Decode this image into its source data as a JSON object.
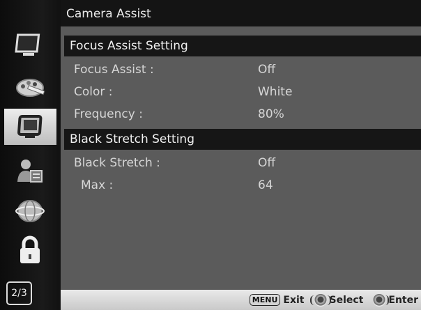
{
  "window": {
    "title": "Camera Assist"
  },
  "sidebar": {
    "icons": [
      {
        "name": "monitor-icon",
        "active": false
      },
      {
        "name": "palette-icon",
        "active": false
      },
      {
        "name": "screen-icon",
        "active": true
      },
      {
        "name": "user-config-icon",
        "active": false
      },
      {
        "name": "globe-icon",
        "active": false
      },
      {
        "name": "lock-icon",
        "active": false
      }
    ],
    "page_indicator": "2/3"
  },
  "sections": [
    {
      "title": "Focus Assist Setting",
      "items": [
        {
          "label": "Focus Assist :",
          "value": "Off"
        },
        {
          "label": "Color :",
          "value": "White"
        },
        {
          "label": "Frequency :",
          "value": "80%"
        }
      ]
    },
    {
      "title": "Black Stretch Setting",
      "items": [
        {
          "label": "Black Stretch :",
          "value": "Off"
        },
        {
          "label": "Max :",
          "value": "64"
        }
      ]
    }
  ],
  "footer": {
    "menu_key": "MENU",
    "exit_label": "Exit",
    "select_label": "Select",
    "enter_label": "Enter"
  },
  "colors": {
    "panel": "#5b5b5b",
    "header": "#161616",
    "active_icon_bg": "#d9d9d9"
  }
}
